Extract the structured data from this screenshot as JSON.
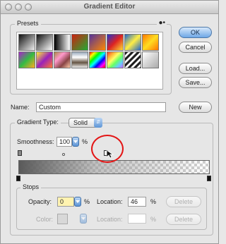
{
  "window": {
    "title": "Gradient Editor"
  },
  "presets": {
    "label": "Presets",
    "swatches": [
      {
        "name": "preset-fg-bg",
        "css": "linear-gradient(135deg,#111,#eee)"
      },
      {
        "name": "preset-fg-transparent",
        "css": "linear-gradient(135deg,#111,#fff)"
      },
      {
        "name": "preset-black-white",
        "css": "linear-gradient(90deg,#000,#fff)"
      },
      {
        "name": "preset-red-green",
        "css": "linear-gradient(135deg,#c21,#2a3)"
      },
      {
        "name": "preset-violet-orange",
        "css": "linear-gradient(135deg,#539,#f80)"
      },
      {
        "name": "preset-blue-red-yellow",
        "css": "linear-gradient(135deg,#23c,#d22,#fd3)"
      },
      {
        "name": "preset-blue-yellow-blue",
        "css": "linear-gradient(135deg,#26c,#fe4,#26c)"
      },
      {
        "name": "preset-orange-yellow",
        "css": "linear-gradient(135deg,#f70,#fd2,#f70)"
      },
      {
        "name": "preset-violet-green",
        "css": "linear-gradient(135deg,#a2c,#3b4,#fa2)"
      },
      {
        "name": "preset-yellow-violet",
        "css": "linear-gradient(135deg,#fe3,#92b,#f73)"
      },
      {
        "name": "preset-copper",
        "css": "linear-gradient(135deg,#a84,#f9c,#844,#fca)"
      },
      {
        "name": "preset-chrome",
        "css": "linear-gradient(180deg,#9ab,#fff,#654,#eee)"
      },
      {
        "name": "preset-spectrum",
        "css": "linear-gradient(135deg,#f00,#ff0,#0f0,#0ff,#00f,#f0f,#f00)"
      },
      {
        "name": "preset-transparent-rainbow",
        "css": "linear-gradient(135deg,#f33,#fa3,#ff6,#6f6,#6cf,#c6f)"
      },
      {
        "name": "preset-transparent-stripes",
        "css": "repeating-linear-gradient(135deg,#222 0 3px,#fff 3px 6px)"
      },
      {
        "name": "preset-checker",
        "css": "linear-gradient(135deg,#fff,#aaa)"
      }
    ]
  },
  "buttons": {
    "ok": "OK",
    "cancel": "Cancel",
    "load": "Load...",
    "save": "Save...",
    "new": "New",
    "delete_opacity": "Delete",
    "delete_color": "Delete"
  },
  "name": {
    "label": "Name:",
    "value": "Custom"
  },
  "gradient": {
    "type_label": "Gradient Type:",
    "type_value": "Solid",
    "smoothness_label": "Smoothness:",
    "smoothness_value": "100",
    "smoothness_unit": "%",
    "bar": {
      "start_color": "#5a5a5a",
      "end_color": "#ffffff",
      "end_opacity": 0
    }
  },
  "stops": {
    "label": "Stops",
    "opacity_label": "Opacity:",
    "opacity_value": "0",
    "opacity_unit": "%",
    "opacity_location_label": "Location:",
    "opacity_location_value": "46",
    "opacity_location_unit": "%",
    "color_label": "Color:",
    "color_location_label": "Location:",
    "color_location_value": "",
    "color_location_unit": "%"
  },
  "colors": {
    "accent": "#6ea7e6",
    "highlight": "#e31515"
  },
  "icons": {
    "presets_menu": "gear-menu-icon",
    "cursor": "pointer-cursor-icon"
  }
}
